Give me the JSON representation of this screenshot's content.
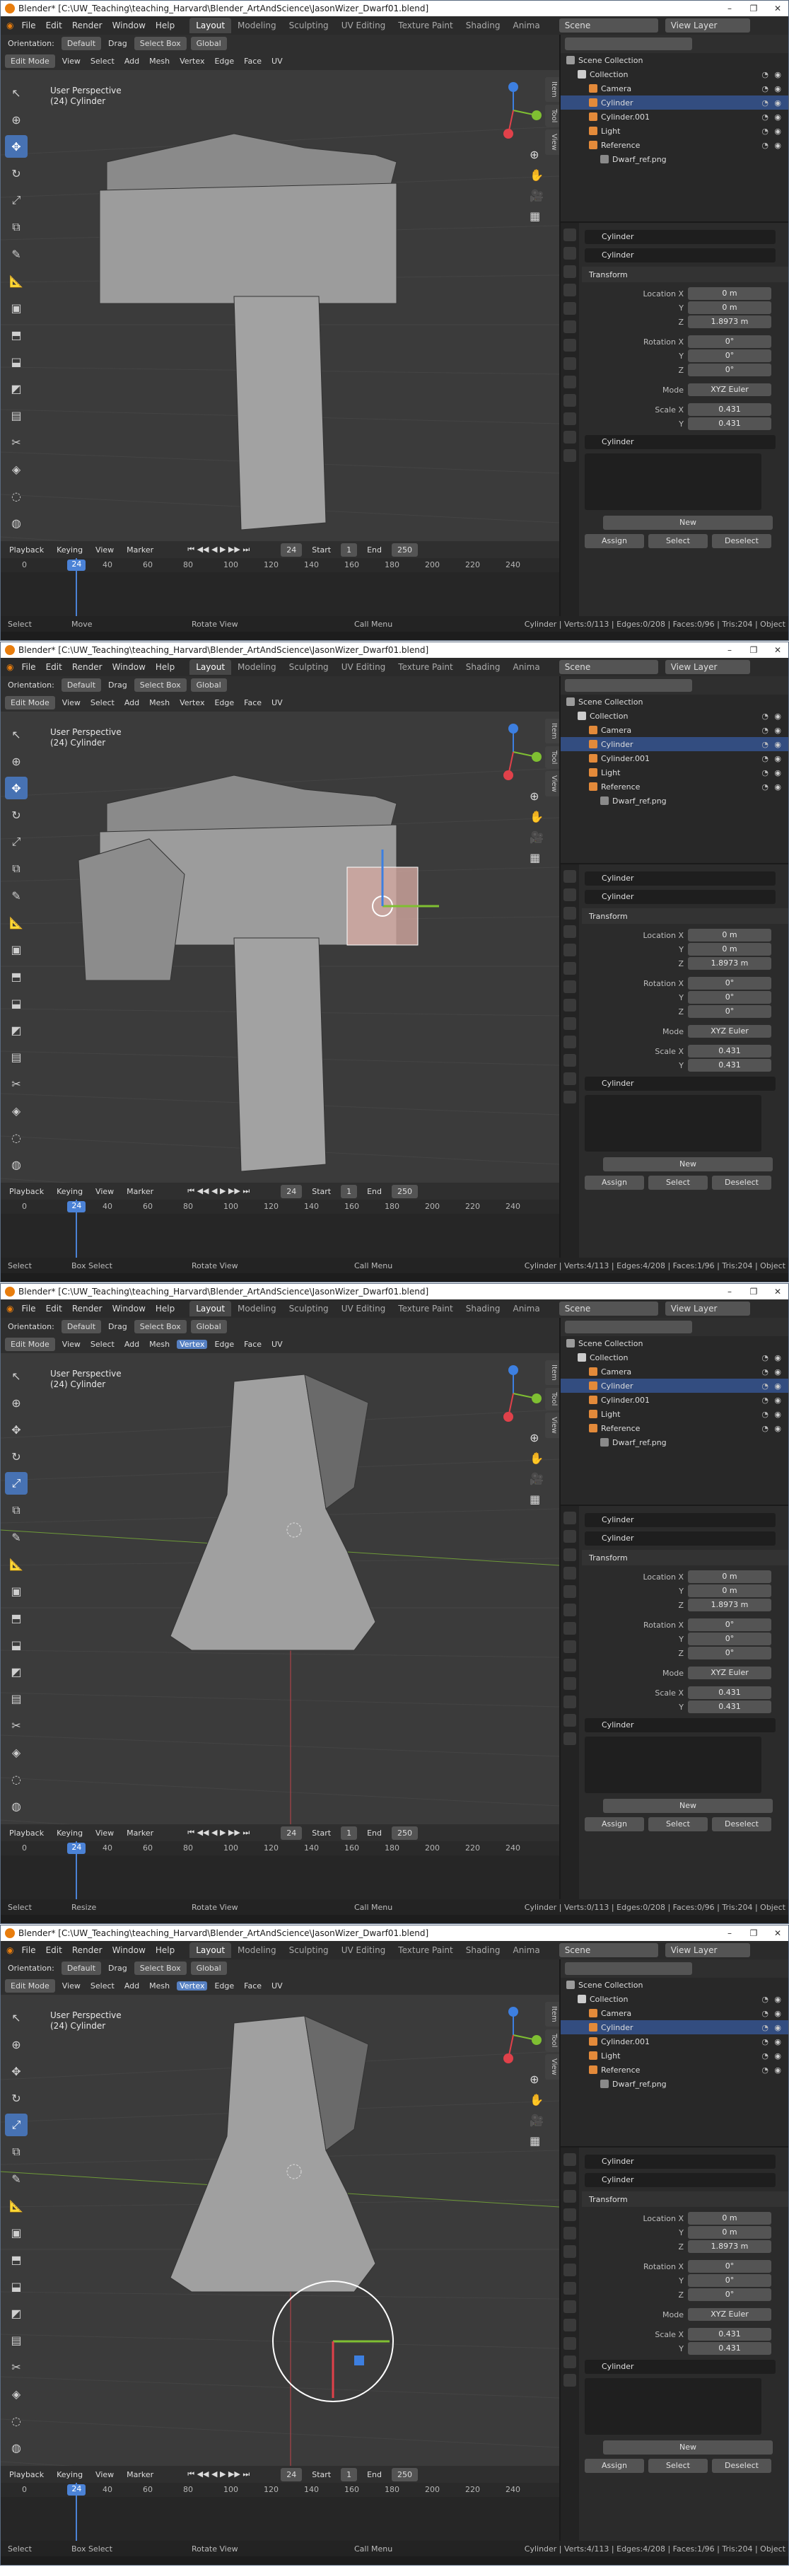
{
  "common": {
    "title": "Blender* [C:\\UW_Teaching\\teaching_Harvard\\Blender_ArtAndScience\\JasonWizer_Dwarf01.blend]",
    "menu": [
      "File",
      "Edit",
      "Render",
      "Window",
      "Help"
    ],
    "workspaces": [
      "Layout",
      "Modeling",
      "Sculpting",
      "UV Editing",
      "Texture Paint",
      "Shading",
      "Anima"
    ],
    "active_workspace": "Layout",
    "scene": "Scene",
    "view_layer": "View Layer",
    "header": {
      "orientation_label": "Orientation:",
      "orientation": "Default",
      "drag_label": "Drag",
      "drag": "Select Box",
      "transform_orientation": "Global",
      "mode": "Edit Mode",
      "menus": [
        "View",
        "Select",
        "Add",
        "Mesh",
        "Vertex",
        "Edge",
        "Face",
        "UV"
      ]
    },
    "viewport_info": [
      "User Perspective",
      "(24) Cylinder"
    ],
    "n_tabs": [
      "Item",
      "Tool",
      "View"
    ],
    "outliner": {
      "rows": [
        {
          "label": "Scene Collection",
          "icon_color": "#9b9b9b",
          "indent": 0
        },
        {
          "label": "Collection",
          "icon_color": "#cccccc",
          "indent": 1
        },
        {
          "label": "Camera",
          "icon_color": "#e38a3a",
          "indent": 2
        },
        {
          "label": "Cylinder",
          "icon_color": "#e38a3a",
          "indent": 2,
          "selected": true
        },
        {
          "label": "Cylinder.001",
          "icon_color": "#e38a3a",
          "indent": 2
        },
        {
          "label": "Light",
          "icon_color": "#e38a3a",
          "indent": 2
        },
        {
          "label": "Reference",
          "icon_color": "#e38a3a",
          "indent": 2
        },
        {
          "label": "Dwarf_ref.png",
          "icon_color": "#8a8a8a",
          "indent": 3
        }
      ]
    },
    "properties": {
      "object_name": "Cylinder",
      "mesh_name": "Cylinder",
      "transform_title": "Transform",
      "location_label": "Location X",
      "loc_x": "0 m",
      "y_label": "Y",
      "loc_y": "0 m",
      "z_label": "Z",
      "loc_z": "1.8973 m",
      "rotation_label": "Rotation X",
      "rot_x": "0°",
      "rot_y": "0°",
      "rot_z": "0°",
      "mode_label": "Mode",
      "mode": "XYZ Euler",
      "scale_label": "Scale X",
      "scale_x": "0.431",
      "scale_y": "0.431",
      "data_name": "Cylinder",
      "new_label": "New",
      "assign_label": "Assign",
      "select_label": "Select",
      "deselect_label": "Deselect"
    },
    "timeline": {
      "playback": "Playback",
      "keying": "Keying",
      "view": "View",
      "marker": "Marker",
      "current_frame": "24",
      "start_label": "Start",
      "start": "1",
      "end_label": "End",
      "end": "250",
      "ticks": [
        "0",
        "24",
        "40",
        "60",
        "80",
        "100",
        "120",
        "140",
        "160",
        "180",
        "200",
        "220",
        "240"
      ]
    }
  },
  "windows": [
    {
      "status": [
        "Select",
        "Move",
        "Rotate View",
        "Call Menu"
      ],
      "stats": "Cylinder | Verts:0/113 | Edges:0/208 | Faces:0/96 | Tris:204 | Object"
    },
    {
      "status": [
        "Select",
        "Box Select",
        "Rotate View",
        "Call Menu"
      ],
      "stats": "Cylinder | Verts:4/113 | Edges:4/208 | Faces:1/96 | Tris:204 | Object"
    },
    {
      "status": [
        "Select",
        "Resize",
        "Rotate View",
        "Call Menu"
      ],
      "stats": "Cylinder | Verts:0/113 | Edges:0/208 | Faces:0/96 | Tris:204 | Object"
    },
    {
      "status": [
        "Select",
        "Box Select",
        "Rotate View",
        "Call Menu"
      ],
      "stats": "Cylinder | Verts:4/113 | Edges:4/208 | Faces:1/96 | Tris:204 | Object"
    }
  ],
  "colors": {
    "accent": "#4772b3",
    "timeline_playhead": "#4b82d6",
    "selected_row": "#334d80",
    "axis_x": "#e0414a",
    "axis_y": "#7fbf32",
    "axis_z": "#3d7fe0"
  }
}
